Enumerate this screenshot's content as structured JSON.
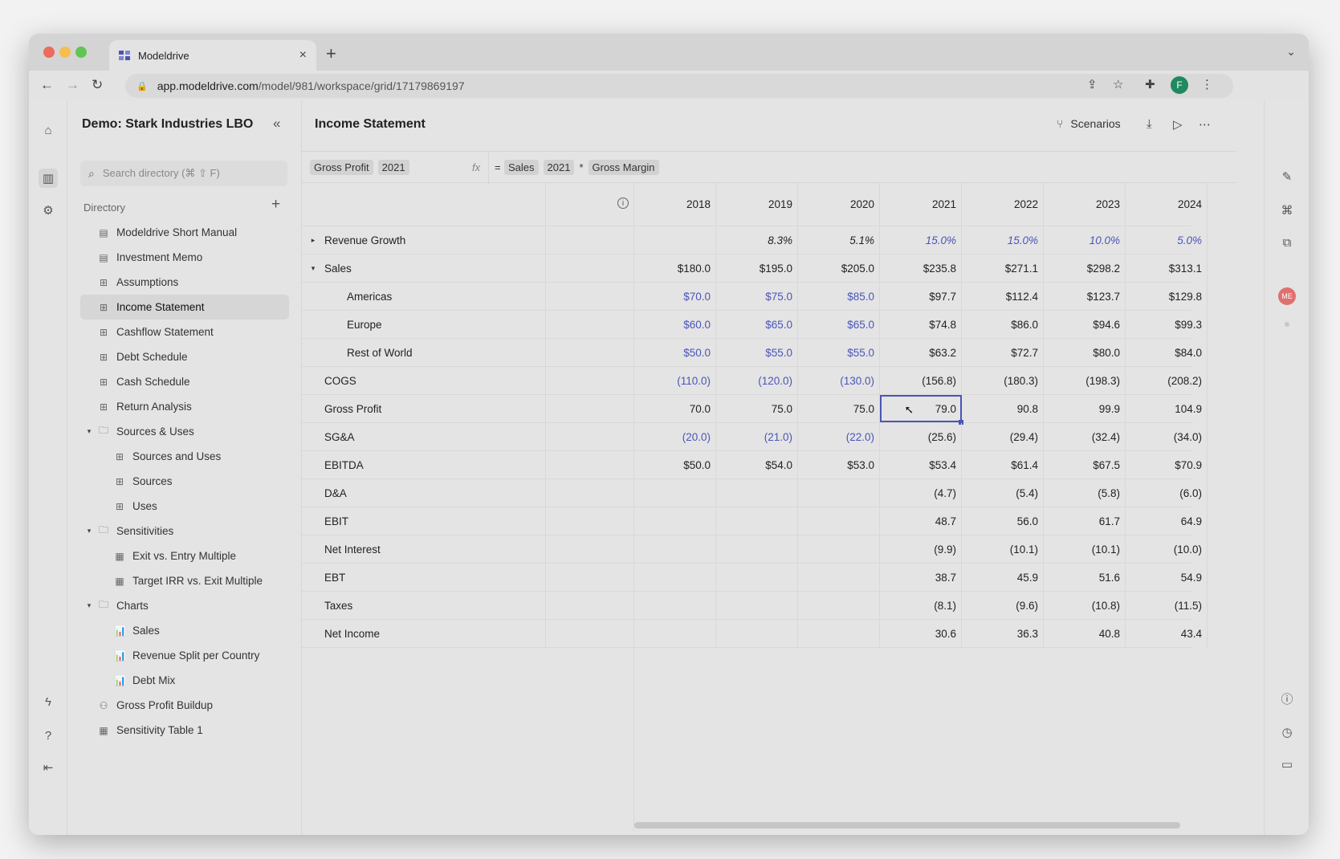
{
  "browser": {
    "tab_title": "Modeldrive",
    "url_host": "app.modeldrive.com",
    "url_path": "/model/981/workspace/grid/17179869197",
    "profile_initial": "F"
  },
  "sidebar": {
    "project_title": "Demo: Stark Industries LBO",
    "search_placeholder": "Search directory (⌘ ⇧ F)",
    "directory_label": "Directory",
    "items": [
      {
        "label": "Modeldrive Short Manual",
        "icon": "document-icon",
        "glyph": "▤",
        "level": 0
      },
      {
        "label": "Investment Memo",
        "icon": "document-icon",
        "glyph": "▤",
        "level": 0
      },
      {
        "label": "Assumptions",
        "icon": "grid-icon",
        "glyph": "⊞",
        "level": 0
      },
      {
        "label": "Income Statement",
        "icon": "grid-icon",
        "glyph": "⊞",
        "level": 0,
        "selected": true
      },
      {
        "label": "Cashflow Statement",
        "icon": "grid-icon",
        "glyph": "⊞",
        "level": 0
      },
      {
        "label": "Debt Schedule",
        "icon": "grid-icon",
        "glyph": "⊞",
        "level": 0
      },
      {
        "label": "Cash Schedule",
        "icon": "grid-icon",
        "glyph": "⊞",
        "level": 0
      },
      {
        "label": "Return Analysis",
        "icon": "grid-icon",
        "glyph": "⊞",
        "level": 0
      },
      {
        "label": "Sources & Uses",
        "icon": "folder-icon",
        "glyph": "🗀",
        "level": 0,
        "folder": true
      },
      {
        "label": "Sources and Uses",
        "icon": "dashboard-icon",
        "glyph": "⊞",
        "level": 1
      },
      {
        "label": "Sources",
        "icon": "grid-icon",
        "glyph": "⊞",
        "level": 1
      },
      {
        "label": "Uses",
        "icon": "grid-icon",
        "glyph": "⊞",
        "level": 1
      },
      {
        "label": "Sensitivities",
        "icon": "folder-icon",
        "glyph": "🗀",
        "level": 0,
        "folder": true
      },
      {
        "label": "Exit vs. Entry Multiple",
        "icon": "table-icon",
        "glyph": "▦",
        "level": 1
      },
      {
        "label": "Target IRR vs. Exit Multiple",
        "icon": "table-icon",
        "glyph": "▦",
        "level": 1
      },
      {
        "label": "Charts",
        "icon": "folder-icon",
        "glyph": "🗀",
        "level": 0,
        "folder": true
      },
      {
        "label": "Sales",
        "icon": "bar-chart-icon",
        "glyph": "📊",
        "level": 1
      },
      {
        "label": "Revenue Split per Country",
        "icon": "bar-chart-icon",
        "glyph": "📊",
        "level": 1
      },
      {
        "label": "Debt Mix",
        "icon": "bar-chart-icon",
        "glyph": "📊",
        "level": 1
      },
      {
        "label": "Gross Profit Buildup",
        "icon": "tree-icon",
        "glyph": "⚇",
        "level": 0
      },
      {
        "label": "Sensitivity Table 1",
        "icon": "table-icon",
        "glyph": "▦",
        "level": 0
      }
    ]
  },
  "main": {
    "title": "Income Statement",
    "scenarios_label": "Scenarios",
    "formula": {
      "ref_name": "Gross Profit",
      "ref_year": "2021",
      "fx": "fx",
      "eq": "=",
      "tokens": [
        "Sales",
        "2021",
        "*",
        "Gross Margin"
      ]
    },
    "years": [
      "2018",
      "2019",
      "2020",
      "2021",
      "2022",
      "2023",
      "2024"
    ],
    "rows": [
      {
        "label": "Revenue Growth",
        "tri": "▸",
        "indent": 0,
        "style": "pct",
        "values": [
          "",
          "8.3%",
          "5.1%",
          "15.0%",
          "15.0%",
          "10.0%",
          "5.0%"
        ],
        "blue": [
          false,
          false,
          false,
          true,
          true,
          true,
          true
        ]
      },
      {
        "label": "Sales",
        "tri": "▾",
        "indent": 0,
        "values": [
          "$180.0",
          "$195.0",
          "$205.0",
          "$235.8",
          "$271.1",
          "$298.2",
          "$313.1"
        ],
        "blue": [
          false,
          false,
          false,
          false,
          false,
          false,
          false
        ]
      },
      {
        "label": "Americas",
        "tri": "",
        "indent": 1,
        "values": [
          "$70.0",
          "$75.0",
          "$85.0",
          "$97.7",
          "$112.4",
          "$123.7",
          "$129.8"
        ],
        "blue": [
          true,
          true,
          true,
          false,
          false,
          false,
          false
        ]
      },
      {
        "label": "Europe",
        "tri": "",
        "indent": 1,
        "values": [
          "$60.0",
          "$65.0",
          "$65.0",
          "$74.8",
          "$86.0",
          "$94.6",
          "$99.3"
        ],
        "blue": [
          true,
          true,
          true,
          false,
          false,
          false,
          false
        ]
      },
      {
        "label": "Rest of World",
        "tri": "",
        "indent": 1,
        "values": [
          "$50.0",
          "$55.0",
          "$55.0",
          "$63.2",
          "$72.7",
          "$80.0",
          "$84.0"
        ],
        "blue": [
          true,
          true,
          true,
          false,
          false,
          false,
          false
        ]
      },
      {
        "label": "COGS",
        "tri": "",
        "indent": 0,
        "values": [
          "(110.0)",
          "(120.0)",
          "(130.0)",
          "(156.8)",
          "(180.3)",
          "(198.3)",
          "(208.2)"
        ],
        "blue": [
          true,
          true,
          true,
          false,
          false,
          false,
          false
        ]
      },
      {
        "label": "Gross Profit",
        "tri": "",
        "indent": 0,
        "values": [
          "70.0",
          "75.0",
          "75.0",
          "79.0",
          "90.8",
          "99.9",
          "104.9"
        ],
        "blue": [
          false,
          false,
          false,
          false,
          false,
          false,
          false
        ],
        "selected_col": 3
      },
      {
        "label": "SG&A",
        "tri": "",
        "indent": 0,
        "values": [
          "(20.0)",
          "(21.0)",
          "(22.0)",
          "(25.6)",
          "(29.4)",
          "(32.4)",
          "(34.0)"
        ],
        "blue": [
          true,
          true,
          true,
          false,
          false,
          false,
          false
        ]
      },
      {
        "label": "EBITDA",
        "tri": "",
        "indent": 0,
        "values": [
          "$50.0",
          "$54.0",
          "$53.0",
          "$53.4",
          "$61.4",
          "$67.5",
          "$70.9"
        ],
        "blue": [
          false,
          false,
          false,
          false,
          false,
          false,
          false
        ]
      },
      {
        "label": "D&A",
        "tri": "",
        "indent": 0,
        "values": [
          "",
          "",
          "",
          "(4.7)",
          "(5.4)",
          "(5.8)",
          "(6.0)"
        ],
        "blue": [
          false,
          false,
          false,
          false,
          false,
          false,
          false
        ]
      },
      {
        "label": "EBIT",
        "tri": "",
        "indent": 0,
        "values": [
          "",
          "",
          "",
          "48.7",
          "56.0",
          "61.7",
          "64.9"
        ],
        "blue": [
          false,
          false,
          false,
          false,
          false,
          false,
          false
        ]
      },
      {
        "label": "Net Interest",
        "tri": "",
        "indent": 0,
        "values": [
          "",
          "",
          "",
          "(9.9)",
          "(10.1)",
          "(10.1)",
          "(10.0)"
        ],
        "blue": [
          false,
          false,
          false,
          false,
          false,
          false,
          false
        ]
      },
      {
        "label": "EBT",
        "tri": "",
        "indent": 0,
        "values": [
          "",
          "",
          "",
          "38.7",
          "45.9",
          "51.6",
          "54.9"
        ],
        "blue": [
          false,
          false,
          false,
          false,
          false,
          false,
          false
        ]
      },
      {
        "label": "Taxes",
        "tri": "",
        "indent": 0,
        "values": [
          "",
          "",
          "",
          "(8.1)",
          "(9.6)",
          "(10.8)",
          "(11.5)"
        ],
        "blue": [
          false,
          false,
          false,
          false,
          false,
          false,
          false
        ]
      },
      {
        "label": "Net Income",
        "tri": "",
        "indent": 0,
        "values": [
          "",
          "",
          "",
          "30.6",
          "36.3",
          "40.8",
          "43.4"
        ],
        "blue": [
          false,
          false,
          false,
          false,
          false,
          false,
          false
        ]
      }
    ]
  },
  "right_rail": {
    "avatar_initials": "ME"
  },
  "colors": {
    "input_blue": "#4a55b8",
    "close": "#ec6a5e",
    "minimize": "#f4bf4f",
    "maximize": "#61c554",
    "profile": "#1e8a5e",
    "avatar": "#e07070"
  }
}
